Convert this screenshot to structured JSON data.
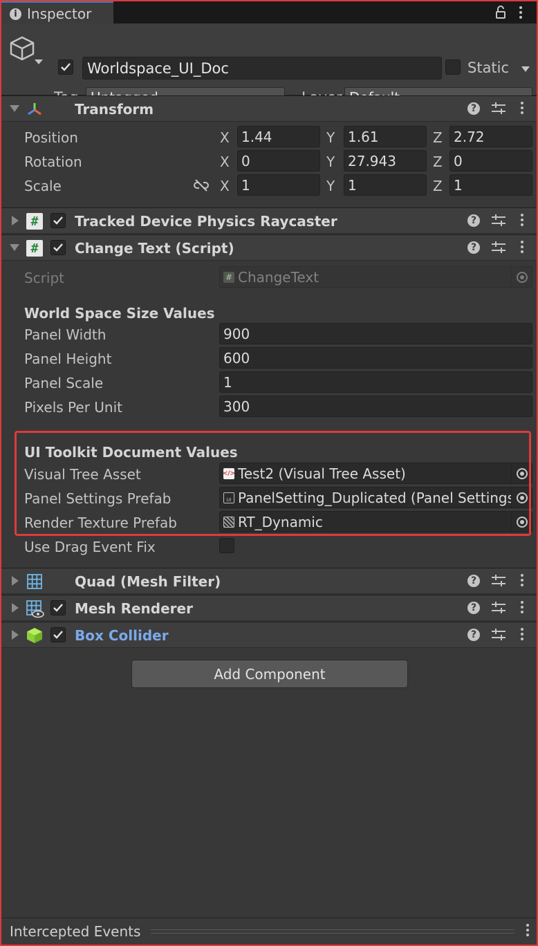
{
  "tab": {
    "title": "Inspector"
  },
  "header": {
    "object_name": "Worldspace_UI_Doc",
    "static_label": "Static",
    "tag_label": "Tag",
    "tag_value": "Untagged",
    "layer_label": "Layer",
    "layer_value": "Default"
  },
  "transform": {
    "title": "Transform",
    "position_label": "Position",
    "rotation_label": "Rotation",
    "scale_label": "Scale",
    "axes": {
      "x": "X",
      "y": "Y",
      "z": "Z"
    },
    "position": {
      "x": "1.44",
      "y": "1.61",
      "z": "2.72"
    },
    "rotation": {
      "x": "0",
      "y": "27.943",
      "z": "0"
    },
    "scale": {
      "x": "1",
      "y": "1",
      "z": "1"
    }
  },
  "raycaster": {
    "title": "Tracked Device Physics Raycaster"
  },
  "change_text": {
    "title": "Change Text (Script)",
    "script_label": "Script",
    "script_value": "ChangeText",
    "section1_title": "World Space Size Values",
    "panel_width_label": "Panel Width",
    "panel_width": "900",
    "panel_height_label": "Panel Height",
    "panel_height": "600",
    "panel_scale_label": "Panel Scale",
    "panel_scale": "1",
    "ppu_label": "Pixels Per Unit",
    "ppu": "300",
    "section2_title": "UI Toolkit Document Values",
    "vta_label": "Visual Tree Asset",
    "vta_value": "Test2 (Visual Tree Asset)",
    "psp_label": "Panel Settings Prefab",
    "psp_value": "PanelSetting_Duplicated (Panel Settings)",
    "rtp_label": "Render Texture Prefab",
    "rtp_value": "RT_Dynamic",
    "drag_label": "Use Drag Event Fix"
  },
  "mesh_filter": {
    "title": "Quad (Mesh Filter)"
  },
  "mesh_renderer": {
    "title": "Mesh Renderer"
  },
  "box_collider": {
    "title": "Box Collider"
  },
  "add_component": "Add Component",
  "footer": {
    "title": "Intercepted Events"
  },
  "colors": {
    "highlight": "#e03a3a",
    "box_collider_title": "#7ba9ea",
    "tab_accent": "#3a79bb"
  }
}
